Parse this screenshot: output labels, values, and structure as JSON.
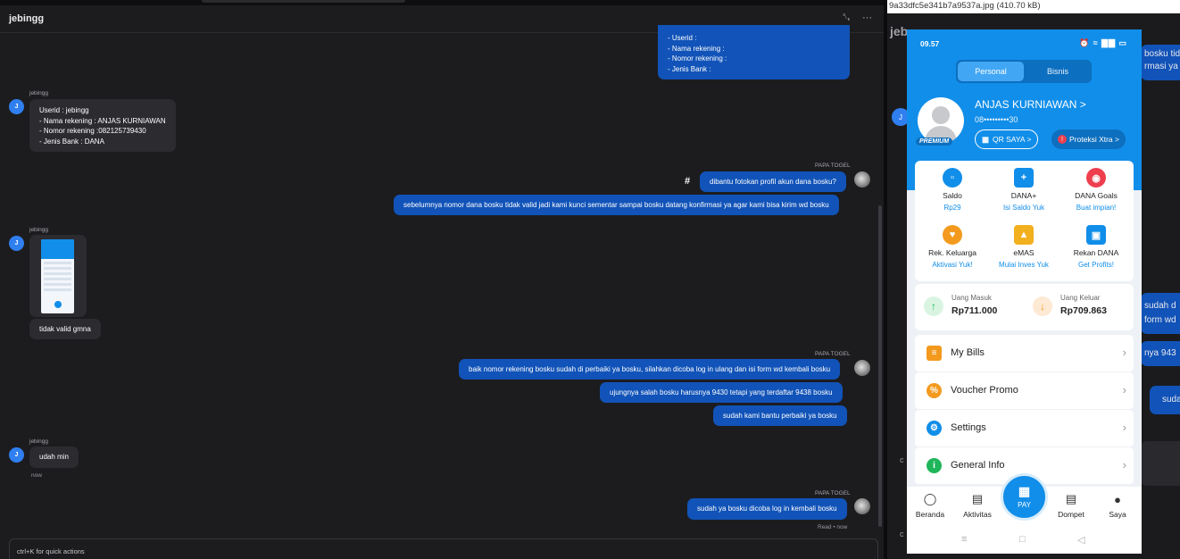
{
  "chat": {
    "title": "jebingg",
    "link_icon": "␐",
    "more_icon": "···",
    "top_form": [
      "- Userid :",
      "- Nama rekening :",
      "- Nomor rekening :",
      "- Jenis Bank :"
    ],
    "msg1_sender": "jebingg",
    "msg1_lines": [
      "Userid : jebingg",
      "- Nama rekening : ANJAS KURNIAWAN",
      "- Nomor rekening :082125739430",
      "- Jenis Bank : DANA"
    ],
    "avatar_letter": "J",
    "papa1_sender": "PAPA TOGEL",
    "hash": "#",
    "papa1_msg1": "dibantu fotokan profil akun dana bosku?",
    "papa1_msg2": "sebelumnya nomor dana bosku tidak valid jadi kami kunci sementar sampai bosku datang konfirmasi ya agar kami bisa kirim wd bosku",
    "msg2_sender": "jebingg",
    "msg2_text": "tidak valid gmna",
    "papa2_sender": "PAPA TOGEL",
    "papa2_msg1": "baik nomor rekening bosku sudah di perbaiki ya bosku, silahkan dicoba log in ulang dan isi form wd kembali bosku",
    "papa2_msg2": "ujungnya salah bosku harusnya 9430 tetapi yang terdaftar 9438 bosku",
    "papa2_msg3": "sudah kami bantu perbaiki ya bosku",
    "msg3_sender": "jebingg",
    "msg3_text": "udah min",
    "msg3_time": "now",
    "papa3_sender": "PAPA TOGEL",
    "papa3_msg1": "sudah ya bosku dicoba log in kembali bosku",
    "read_status": "Read • now",
    "input_placeholder": "ctrl+K for quick actions"
  },
  "bg": {
    "file_label": "9a33dfc5e341b7a9537a.jpg (410.70 kB)",
    "title_partial": "jeb",
    "b1": "bosku tida",
    "b2": "rmasi ya",
    "b3": "sudah d",
    "b4": "form wd",
    "b5": "nya 943",
    "b6": "suda",
    "avatar_letter": "J",
    "input_c": "c",
    "input_c2": "c"
  },
  "phone": {
    "time": "09.57",
    "status_icons": "⏰ ≈ ▇▇ ▭",
    "tab_personal": "Personal",
    "tab_bisnis": "Bisnis",
    "premium": "PREMIUM",
    "name": "ANJAS KURNIAWAN >",
    "phone": "08•••••••••30",
    "qr_label": "QR SAYA >",
    "proteksi_label": "Proteksi Xtra >",
    "features": [
      {
        "title": "Saldo",
        "sub": "Rp29"
      },
      {
        "title": "DANA+",
        "sub": "Isi Saldo Yuk"
      },
      {
        "title": "DANA Goals",
        "sub": "Buat impian!"
      },
      {
        "title": "Rek. Keluarga",
        "sub": "Aktivasi Yuk!"
      },
      {
        "title": "eMAS",
        "sub": "Mulai Inves Yuk"
      },
      {
        "title": "Rekan DANA",
        "sub": "Get Profits!"
      }
    ],
    "uang_masuk_label": "Uang Masuk",
    "uang_masuk_value": "Rp711.000",
    "uang_keluar_label": "Uang Keluar",
    "uang_keluar_value": "Rp709.863",
    "menu": [
      "My Bills",
      "Voucher Promo",
      "Settings",
      "General Info"
    ],
    "nav": [
      "Beranda",
      "Aktivitas",
      "PAY",
      "Dompet",
      "Saya"
    ],
    "accent": "#118ee9"
  }
}
